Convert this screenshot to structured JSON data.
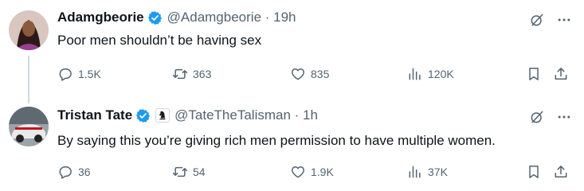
{
  "tweets": [
    {
      "name": "Adamgbeorie",
      "handle_time": "@Adamgbeorie · 19h",
      "text": "Poor men shouldn’t be having sex",
      "reply_count": "1.5K",
      "retweet_count": "363",
      "like_count": "835",
      "view_count": "120K"
    },
    {
      "name": "Tristan Tate",
      "handle_time": "@TateTheTalisman · 1h",
      "text": "By saying this you’re giving rich men permission to have multiple women.",
      "reply_count": "36",
      "retweet_count": "54",
      "like_count": "1.9K",
      "view_count": "37K"
    }
  ],
  "colors": {
    "verified": "#1d9bf0",
    "secondary_text": "#536471",
    "thread_line": "#cfd9de"
  },
  "icons": [
    "verified-badge-icon",
    "grok-icon",
    "more-icon",
    "reply-icon",
    "retweet-icon",
    "like-icon",
    "views-icon",
    "bookmark-icon",
    "share-icon",
    "chess-knight-icon"
  ]
}
